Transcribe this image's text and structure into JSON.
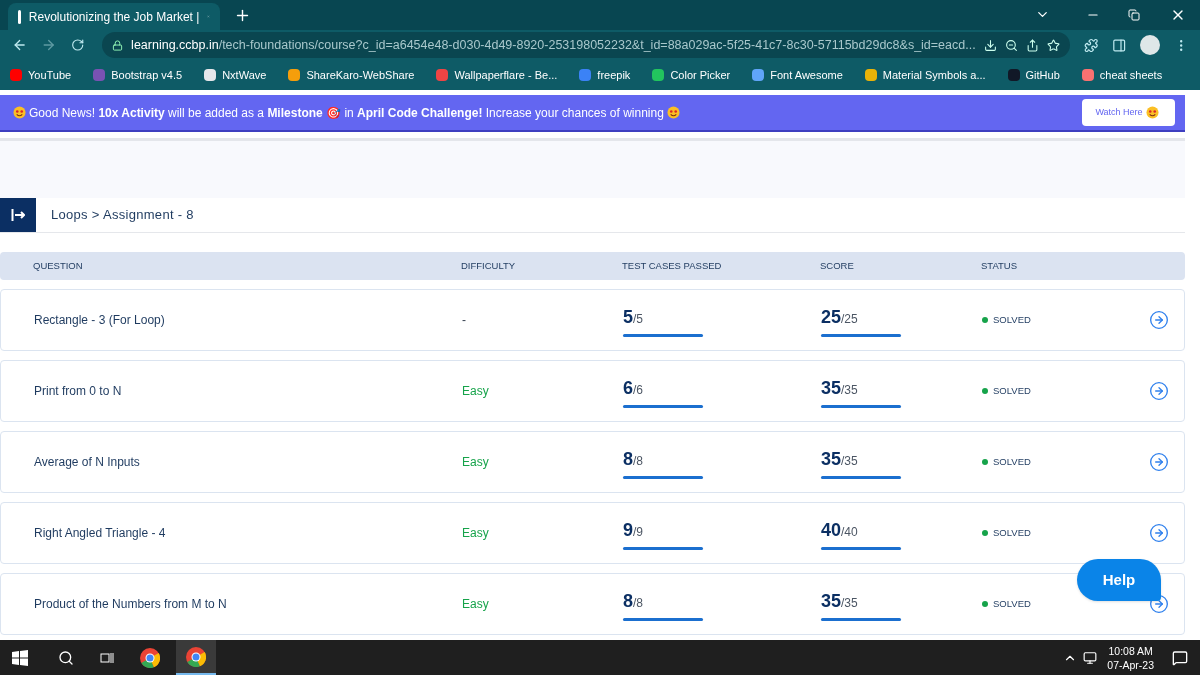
{
  "browser": {
    "tab_title": "Revolutionizing the Job Market |",
    "url_host": "learning.ccbp.in",
    "url_path": "/tech-foundations/course?c_id=a6454e48-d030-4d49-8920-253198052232&t_id=88a029ac-5f25-41c7-8c30-57115bd29dc8&s_id=eacd...",
    "bookmarks": [
      {
        "label": "YouTube",
        "color": "#ff0000"
      },
      {
        "label": "Bootstrap v4.5",
        "color": "#7952b3"
      },
      {
        "label": "NxtWave",
        "color": "#e5e7eb"
      },
      {
        "label": "ShareKaro-WebShare",
        "color": "#f59e0b"
      },
      {
        "label": "Wallpaperflare - Be...",
        "color": "#ef4444"
      },
      {
        "label": "freepik",
        "color": "#3b82f6"
      },
      {
        "label": "Color Picker",
        "color": "#22c55e"
      },
      {
        "label": "Font Awesome",
        "color": "#60a5fa"
      },
      {
        "label": "Material Symbols a...",
        "color": "#eab308"
      },
      {
        "label": "GitHub",
        "color": "#111827"
      },
      {
        "label": "cheat sheets",
        "color": "#f87171"
      }
    ]
  },
  "banner": {
    "text": "Good News! **10x Activity** will be added as a **Milestone** 🎯 in **April Code Challenge!** Increase your chances of winning",
    "button": "Watch Here"
  },
  "breadcrumb": "Loops > Assignment - 8",
  "table": {
    "columns": [
      "QUESTION",
      "DIFFICULTY",
      "TEST CASES PASSED",
      "SCORE",
      "STATUS"
    ],
    "rows": [
      {
        "question": "Rectangle - 3 (For Loop)",
        "difficulty": "-",
        "tests": {
          "value": "5",
          "total": "/5",
          "level": 1
        },
        "score": {
          "value": "25",
          "total": "/25",
          "level": 1
        },
        "status": "SOLVED",
        "color": "#16a34a"
      },
      {
        "question": "Print from 0 to N",
        "difficulty": "Easy",
        "tests": {
          "value": "6",
          "total": "/6",
          "level": 1
        },
        "score": {
          "value": "35",
          "total": "/35",
          "level": 1
        },
        "status": "SOLVED",
        "color": "#16a34a"
      },
      {
        "question": "Average of N Inputs",
        "difficulty": "Easy",
        "tests": {
          "value": "8",
          "total": "/8",
          "level": 1
        },
        "score": {
          "value": "35",
          "total": "/35",
          "level": 1
        },
        "status": "SOLVED",
        "color": "#16a34a"
      },
      {
        "question": "Right Angled Triangle - 4",
        "difficulty": "Easy",
        "tests": {
          "value": "9",
          "total": "/9",
          "level": 1
        },
        "score": {
          "value": "40",
          "total": "/40",
          "level": 1
        },
        "status": "SOLVED",
        "color": "#16a34a"
      },
      {
        "question": "Product of the Numbers from M to N",
        "difficulty": "Easy",
        "tests": {
          "value": "8",
          "total": "/8",
          "level": 1
        },
        "score": {
          "value": "35",
          "total": "/35",
          "level": 1
        },
        "status": "SOLVED",
        "color": "#16a34a"
      }
    ]
  },
  "help_button": "Help",
  "taskbar": {
    "time": "10:08 AM",
    "date": "07-Apr-23"
  }
}
